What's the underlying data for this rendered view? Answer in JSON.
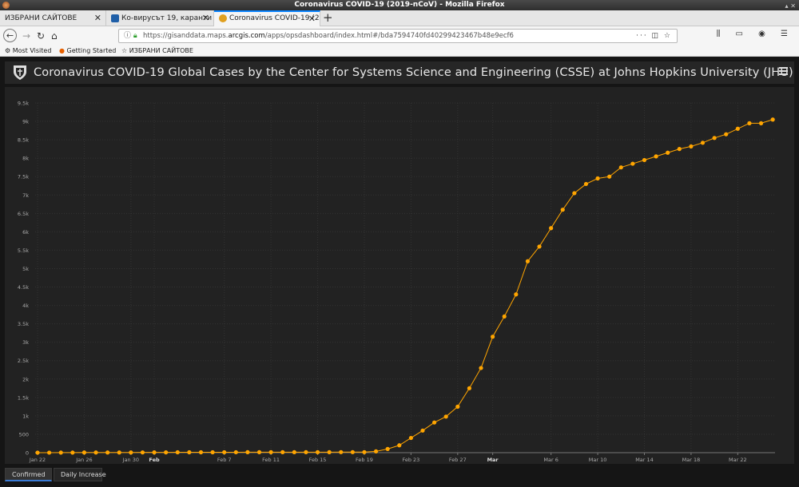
{
  "window": {
    "title": "Coronavirus COVID-19 (2019-nCoV) - Mozilla Firefox"
  },
  "tabs": [
    {
      "label": "ИЗБРАНИ САЙТОВЕ",
      "active": false
    },
    {
      "label": "Ко-вирусът 19, каранти",
      "active": false
    },
    {
      "label": "Coronavirus COVID-19 (2",
      "active": true
    }
  ],
  "address": {
    "prefix": "https://gisanddata.maps.",
    "domain": "arcgis.com",
    "suffix": "/apps/opsdashboard/index.html#/bda7594740fd40299423467b48e9ecf6"
  },
  "bookmarks": [
    {
      "label": "Most Visited",
      "icon": "gear-icon"
    },
    {
      "label": "Getting Started",
      "icon": "firefox-icon"
    },
    {
      "label": "ИЗБРАНИ САЙТОВЕ",
      "icon": "star-icon"
    }
  ],
  "dashboard": {
    "title": "Coronavirus COVID-19 Global Cases by the Center for Systems Science and Engineering (CSSE) at Johns Hopkins University (JHU)"
  },
  "bottom_tabs": [
    {
      "label": "Confirmed",
      "active": true
    },
    {
      "label": "Daily Increase",
      "active": false
    }
  ],
  "colors": {
    "series": "#ffa500",
    "background": "#222222",
    "grid": "#333333"
  },
  "chart_data": {
    "type": "line",
    "title": "",
    "xlabel": "",
    "ylabel": "",
    "ylim": [
      0,
      9500
    ],
    "yticks": [
      0,
      500,
      1000,
      1500,
      2000,
      2500,
      3000,
      3500,
      4000,
      4500,
      5000,
      5500,
      6000,
      6500,
      7000,
      7500,
      8000,
      8500,
      9000,
      9500
    ],
    "ytick_labels": [
      "0",
      "500",
      "1k",
      "1.5k",
      "2k",
      "2.5k",
      "3k",
      "3.5k",
      "4k",
      "4.5k",
      "5k",
      "5.5k",
      "6k",
      "6.5k",
      "7k",
      "7.5k",
      "8k",
      "8.5k",
      "9k",
      "9.5k"
    ],
    "xtick_labels": [
      {
        "label": "Jan 22",
        "day": 0,
        "bold": false
      },
      {
        "label": "Jan 26",
        "day": 4,
        "bold": false
      },
      {
        "label": "Jan 30",
        "day": 8,
        "bold": false
      },
      {
        "label": "Feb",
        "day": 10,
        "bold": true
      },
      {
        "label": "Feb 7",
        "day": 16,
        "bold": false
      },
      {
        "label": "Feb 11",
        "day": 20,
        "bold": false
      },
      {
        "label": "Feb 15",
        "day": 24,
        "bold": false
      },
      {
        "label": "Feb 19",
        "day": 28,
        "bold": false
      },
      {
        "label": "Feb 23",
        "day": 32,
        "bold": false
      },
      {
        "label": "Feb 27",
        "day": 36,
        "bold": false
      },
      {
        "label": "Mar",
        "day": 39,
        "bold": true
      },
      {
        "label": "Mar 6",
        "day": 44,
        "bold": false
      },
      {
        "label": "Mar 10",
        "day": 48,
        "bold": false
      },
      {
        "label": "Mar 14",
        "day": 52,
        "bold": false
      },
      {
        "label": "Mar 18",
        "day": 56,
        "bold": false
      },
      {
        "label": "Mar 22",
        "day": 60,
        "bold": false
      }
    ],
    "grid": true,
    "series": [
      {
        "values": [
          1,
          1,
          2,
          2,
          5,
          5,
          5,
          5,
          5,
          7,
          8,
          8,
          11,
          11,
          11,
          11,
          12,
          12,
          13,
          13,
          13,
          13,
          13,
          13,
          13,
          13,
          15,
          15,
          15,
          35,
          100,
          200,
          400,
          600,
          820,
          980,
          1250,
          1750,
          2300,
          3150,
          3700,
          4300,
          5200,
          5600,
          6100,
          6600,
          7050,
          7300,
          7450,
          7500,
          7750,
          7850,
          7950,
          8050,
          8150,
          8250,
          8320,
          8420,
          8550,
          8650,
          8800,
          8950,
          8950,
          9050
        ]
      }
    ]
  }
}
